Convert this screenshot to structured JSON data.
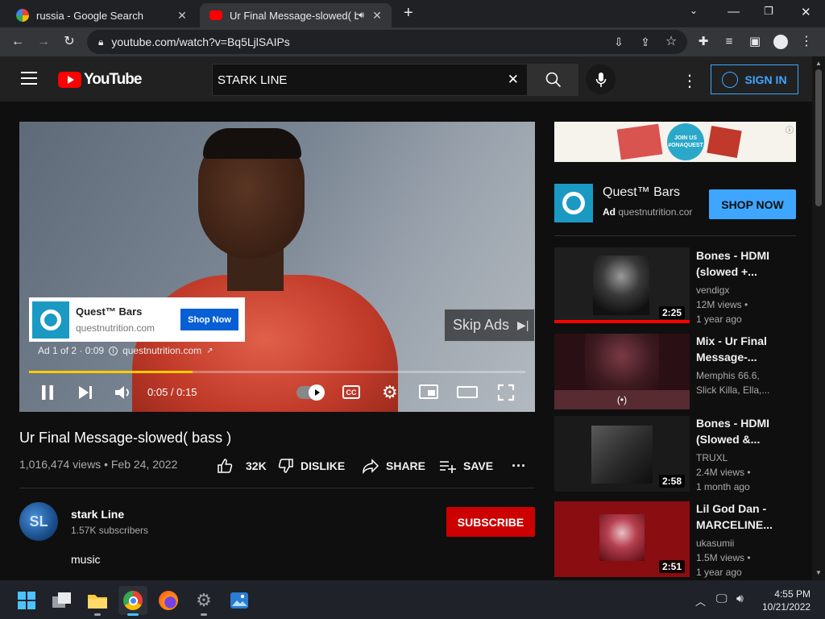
{
  "browser": {
    "tabs": [
      {
        "title": "russia - Google Search"
      },
      {
        "title": "Ur Final Message-slowed( ba"
      }
    ],
    "url": "youtube.com/watch?v=Bq5LjlSAIPs"
  },
  "youtube": {
    "logo_text": "YouTube",
    "search_value": "STARK LINE",
    "sign_in": "SIGN IN"
  },
  "player": {
    "ad_card": {
      "brand": "Quest™ Bars",
      "domain": "questnutrition.com",
      "cta": "Shop Now"
    },
    "ad_info": "Ad 1 of 2 · 0:09",
    "ad_domain": "questnutrition.com",
    "skip_label": "Skip Ads",
    "time": "0:05 / 0:15",
    "progress_fraction": 0.33
  },
  "video": {
    "title": "Ur Final Message-slowed( bass )",
    "meta": "1,016,474 views • Feb 24, 2022",
    "likes": "32K",
    "dislike": "DISLIKE",
    "share": "SHARE",
    "save": "SAVE"
  },
  "channel": {
    "name": "stark Line",
    "subscribers": "1.57K subscribers",
    "subscribe": "SUBSCRIBE",
    "description": "music"
  },
  "sidebar_ad": {
    "brand": "Quest™ Bars",
    "ad_label": "Ad",
    "domain": "questnutrition.cor",
    "cta": "SHOP NOW",
    "banner_text_1": "JOIN US",
    "banner_text_2": "#ONAQUEST"
  },
  "recommendations": [
    {
      "title_1": "Bones - HDMI",
      "title_2": "(slowed +...",
      "channel": "vendigx",
      "views": "12M views •",
      "age": "1 year ago",
      "duration": "2:25"
    },
    {
      "title_1": "Mix - Ur Final",
      "title_2": "Message-...",
      "channel": "Memphis 66.6,",
      "views": "Slick Killa, Ella,...",
      "age": "",
      "duration": "(•)"
    },
    {
      "title_1": "Bones - HDMI",
      "title_2": "(Slowed &...",
      "channel": "TRUXL",
      "views": "2.4M views •",
      "age": "1 month ago",
      "duration": "2:58"
    },
    {
      "title_1": "Lil God Dan -",
      "title_2": "MARCELINE...",
      "channel": "ukasumii",
      "views": "1.5M views •",
      "age": "1 year ago",
      "duration": "2:51"
    }
  ],
  "taskbar": {
    "time": "4:55 PM",
    "date": "10/21/2022"
  },
  "colors": {
    "accent": "#3ea6ff",
    "youtube_red": "#ff0000",
    "subscribe": "#cc0000",
    "shop_now": "#3ea6ff"
  }
}
